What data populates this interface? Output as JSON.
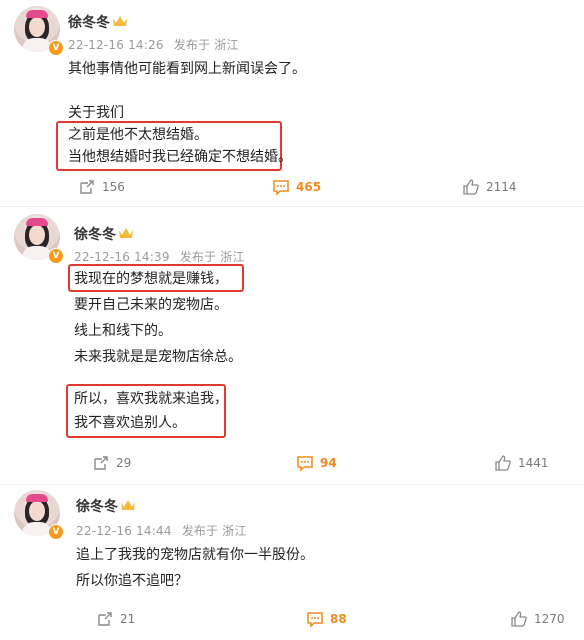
{
  "colors": {
    "highlight_box": "#e0392f",
    "comment_accent": "#f08a1c",
    "meta_text": "#9a9a9a"
  },
  "posts": [
    {
      "author": "徐冬冬",
      "timestamp": "22-12-16 14:26",
      "location": "发布于 浙江",
      "lines": [
        "其他事情他可能看到网上新闻误会了。",
        "关于我们",
        "之前是他不太想结婚。",
        "当他想结婚时我已经确定不想结婚。"
      ],
      "reposts": "156",
      "comments": "465",
      "likes": "2114"
    },
    {
      "author": "徐冬冬",
      "timestamp": "22-12-16 14:39",
      "location": "发布于 浙江",
      "lines": [
        "我现在的梦想就是赚钱，",
        "要开自己未来的宠物店。",
        "线上和线下的。",
        "未来我就是是宠物店徐总。",
        "所以，喜欢我就来追我，",
        "我不喜欢追别人。"
      ],
      "reposts": "29",
      "comments": "94",
      "likes": "1441"
    },
    {
      "author": "徐冬冬",
      "timestamp": "22-12-16 14:44",
      "location": "发布于 浙江",
      "lines": [
        "追上了我我的宠物店就有你一半股份。",
        "所以你追不追吧？"
      ],
      "reposts": "21",
      "comments": "88",
      "likes": "1270"
    }
  ],
  "icons": {
    "repost": "repost-icon",
    "comment": "comment-icon",
    "like": "thumbs-up-icon",
    "badge": "verified-v-icon",
    "crown": "crown-icon"
  }
}
